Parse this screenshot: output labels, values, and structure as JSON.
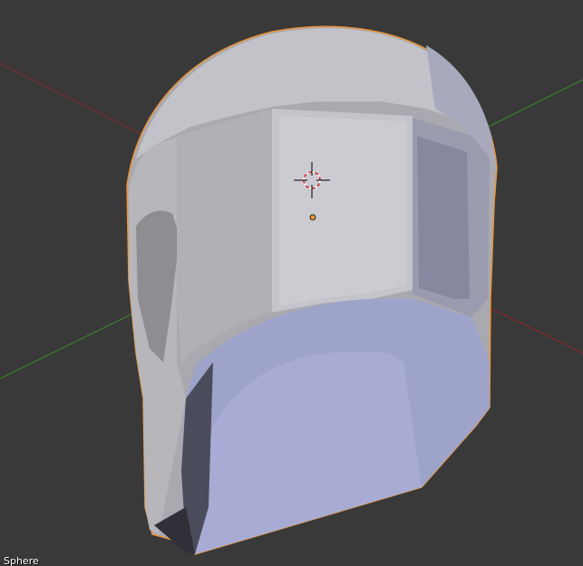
{
  "viewport": {
    "object_name": "Sphere",
    "colors": {
      "background": "#393939",
      "x_axis": "#8a2b2b",
      "y_axis": "#3c8a2c",
      "selection_outline": "#e8953a",
      "mesh_light": "#b9b9be",
      "mesh_blue": "#9ea3c9"
    },
    "icons": {
      "cursor": "3d-cursor-icon",
      "origin": "object-origin-icon"
    }
  }
}
